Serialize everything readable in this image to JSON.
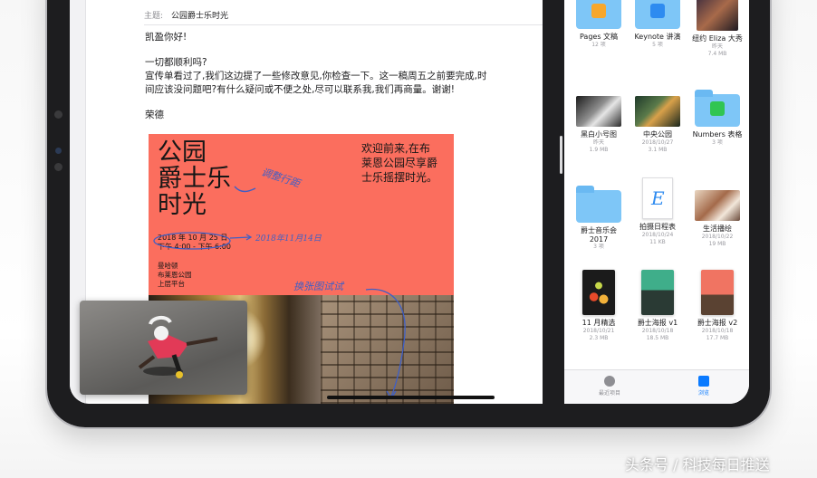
{
  "mail": {
    "subject_label": "主题:",
    "subject_value": "公园爵士乐时光",
    "greeting": "凯盈你好!",
    "line1": "一切都顺利吗?",
    "line2": "宣传单看过了,我们这边提了一些修改意见,你检查一下。这一稿周五之前要完成,时",
    "line3": "间应该没问题吧?有什么疑问或不便之处,尽可以联系我,我们再商量。谢谢!",
    "signature": "荣德"
  },
  "poster": {
    "title_lines": [
      "公园",
      "爵士乐",
      "时光"
    ],
    "right_lines": [
      "欢迎前来,在布",
      "莱恩公园尽享爵",
      "士乐摇摆时光。"
    ],
    "date_line1": "2018 年 10 月 25 日",
    "date_line2": "下午 4:00 - 下午 6:00",
    "venue_lines": [
      "曼哈顿",
      "布莱恩公园",
      "上层平台"
    ],
    "annotations": {
      "spacing": "调整行距",
      "new_date": "2018年11月14日",
      "paper_test": "换张图试试"
    }
  },
  "files": {
    "items": [
      {
        "name": "Pages 文稿",
        "meta1": "12 项",
        "meta2": ""
      },
      {
        "name": "Keynote 讲演",
        "meta1": "5 项",
        "meta2": ""
      },
      {
        "name": "纽约 Eliza 大秀",
        "meta1": "昨天",
        "meta2": "7.4 MB"
      },
      {
        "name": "黑白小号图",
        "meta1": "昨天",
        "meta2": "1.9 MB"
      },
      {
        "name": "中央公园",
        "meta1": "2018/10/27",
        "meta2": "3.1 MB"
      },
      {
        "name": "Numbers 表格",
        "meta1": "3 项",
        "meta2": ""
      },
      {
        "name": "爵士音乐会",
        "name2": "2017",
        "meta1": "3 项",
        "meta2": ""
      },
      {
        "name": "拍摄日程表",
        "meta1": "2018/10/24",
        "meta2": "11 KB"
      },
      {
        "name": "生活播绘",
        "meta1": "2018/10/22",
        "meta2": "19 MB"
      },
      {
        "name": "11 月精选",
        "meta1": "2018/10/21",
        "meta2": "2.3 MB"
      },
      {
        "name": "爵士海报 v1",
        "meta1": "2018/10/18",
        "meta2": "18.5 MB"
      },
      {
        "name": "爵士海报 v2",
        "meta1": "2018/10/18",
        "meta2": "17.7 MB"
      }
    ],
    "tabs": {
      "recent": "最近项目",
      "browse": "浏览"
    }
  },
  "colors": {
    "accent": "#0a7aff",
    "poster_red": "#fb6e5e",
    "folder_blue": "#7ec6f7",
    "annotation_blue": "#3e5fc6"
  },
  "watermark": "头条号 / 科技每日推送"
}
